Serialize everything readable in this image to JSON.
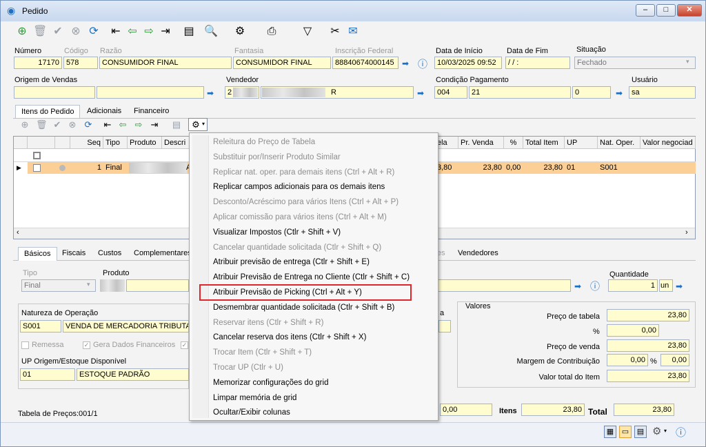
{
  "window": {
    "title": "Pedido",
    "min": "‒",
    "max": "□",
    "close": "✕"
  },
  "header": {
    "numero_label": "Número",
    "numero_value": "17170",
    "codigo_label": "Código",
    "codigo_value": "578",
    "razao_label": "Razão",
    "razao_value": "CONSUMIDOR FINAL",
    "fantasia_label": "Fantasia",
    "fantasia_value": "CONSUMIDOR FINAL",
    "inscricao_label": "Inscrição Federal",
    "inscricao_value": "88840674000145",
    "data_inicio_label": "Data de Início",
    "data_inicio_value": "10/03/2025 09:52",
    "data_fim_label": "Data de Fim",
    "data_fim_value": "/ /     :",
    "situacao_label": "Situação",
    "situacao_value": "Fechado",
    "origem_label": "Origem de Vendas",
    "vendedor_label": "Vendedor",
    "vendedor_code": "2",
    "vendedor_name_end": "R",
    "condicao_label": "Condição Pagamento",
    "condicao_code": "004",
    "condicao_value": "21",
    "zero_value": "0",
    "usuario_label": "Usuário",
    "usuario_value": "sa"
  },
  "tabs": [
    "Itens do Pedido",
    "Adicionais",
    "Financeiro"
  ],
  "grid": {
    "headers": [
      "Seq",
      "Tipo",
      "Produto",
      "Descri",
      "ela",
      "Pr. Venda",
      "%",
      "Total Item",
      "UP",
      "Nat. Oper.",
      "Valor negociad"
    ],
    "row": {
      "seq": "1",
      "tipo": "Final",
      "desc_frag": "A",
      "tabela": "3,80",
      "pr_venda": "23,80",
      "pct": "0,00",
      "total": "23,80",
      "up": "01",
      "natop": "S001"
    }
  },
  "bottom_tabs": [
    "Básicos",
    "Fiscais",
    "Custos",
    "Complementares",
    "es",
    "Vendedores"
  ],
  "basicos": {
    "tipo_label": "Tipo",
    "tipo_value": "Final",
    "produto_label": "Produto",
    "quantidade_label": "Quantidade",
    "quantidade_value": "1",
    "unit": "un",
    "natureza_label": "Natureza de Operação",
    "natureza_code": "S001",
    "natureza_value": "VENDA DE MERCADORIA TRIBUTA",
    "remessa_label": "Remessa",
    "gera_label": "Gera Dados Financeiros",
    "up_label": "UP Origem/Estoque Disponível",
    "up_code": "01",
    "up_value": "ESTOQUE PADRÃO",
    "tabela_frag": "a",
    "valores_label": "Valores",
    "preco_tabela_label": "Preço de tabela",
    "preco_tabela_value": "23,80",
    "pct_label": "%",
    "pct_value": "0,00",
    "preco_venda_label": "Preço de venda",
    "preco_venda_value": "23,80",
    "margem_label": "Margem de Contribuição",
    "margem_pct": "0,00",
    "margem_sym": "%",
    "margem_value": "0,00",
    "total_item_label": "Valor total do Item",
    "total_item_value": "23,80"
  },
  "footer": {
    "tabela_precos": "Tabela de Preços:001/1",
    "field_000": "0,00",
    "itens_label": "Itens",
    "itens_value": "23,80",
    "total_label": "Total",
    "total_value": "23,80"
  },
  "context_menu": [
    {
      "label": "Releitura do Preço de Tabela",
      "enabled": false
    },
    {
      "label": "Substituir por/Inserir Produto Similar",
      "enabled": false
    },
    {
      "label": "Replicar nat. oper. para demais itens (Ctrl + Alt + R)",
      "enabled": false
    },
    {
      "label": "Replicar campos adicionais para os demais itens",
      "enabled": true
    },
    {
      "label": "Desconto/Acréscimo para vários Itens (Ctrl + Alt + P)",
      "enabled": false
    },
    {
      "label": "Aplicar comissão para vários itens (Ctrl + Alt + M)",
      "enabled": false
    },
    {
      "label": "Visualizar Impostos (Ctlr + Shift + V)",
      "enabled": true
    },
    {
      "label": "Cancelar quantidade solicitada (Ctlr + Shift + Q)",
      "enabled": false
    },
    {
      "label": "Atribuir previsão de entrega (Ctlr + Shift + E)",
      "enabled": true
    },
    {
      "label": "Atribuir Previsão de Entrega no Cliente (Ctlr + Shift + C)",
      "enabled": true
    },
    {
      "label": "Atribuir Previsão de Picking (Ctrl + Alt + Y)",
      "enabled": true
    },
    {
      "label": "Desmembrar quantidade solicitada (Ctlr + Shift + B)",
      "enabled": true
    },
    {
      "label": "Reservar itens (Ctlr + Shift + R)",
      "enabled": false
    },
    {
      "label": "Cancelar reserva dos itens (Ctlr + Shift + X)",
      "enabled": true
    },
    {
      "label": "Trocar Item (Ctlr + Shift + T)",
      "enabled": false
    },
    {
      "label": "Trocar UP (Ctlr + U)",
      "enabled": false
    },
    {
      "label": "Memorizar configurações do grid",
      "enabled": true
    },
    {
      "label": "Limpar memória de grid",
      "enabled": true
    },
    {
      "label": "Ocultar/Exibir colunas",
      "enabled": true
    }
  ],
  "colors": {
    "highlight": "#e0262a",
    "selected_row": "#fbcf95",
    "field_bg": "#fffccf"
  }
}
